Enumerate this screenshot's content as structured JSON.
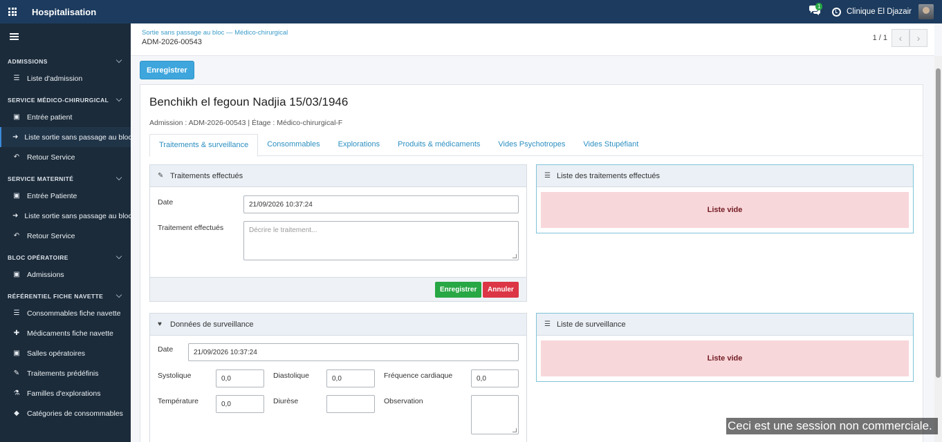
{
  "topbar": {
    "title": "Hospitalisation",
    "chat_badge": "1",
    "company": "Clinique El Djazair"
  },
  "sidebar": {
    "sections": [
      {
        "label": "ADMISSIONS",
        "items": [
          "Liste d'admission"
        ]
      },
      {
        "label": "SERVICE MÉDICO-CHIRURGICAL",
        "items": [
          "Entrée patient",
          "Liste sortie sans passage au bloc",
          "Retour Service"
        ]
      },
      {
        "label": "SERVICE MATERNITÉ",
        "items": [
          "Entrée Patiente",
          "Liste sortie sans passage au bloc",
          "Retour Service"
        ]
      },
      {
        "label": "BLOC OPÉRATOIRE",
        "items": [
          "Admissions"
        ]
      },
      {
        "label": "RÉFÉRENTIEL FICHE NAVETTE",
        "items": [
          "Consommables fiche navette",
          "Médicaments fiche navette",
          "Salles opératoires",
          "Traitements prédéfinis",
          "Familles d'explorations",
          "Catégories de consommables"
        ]
      }
    ]
  },
  "control": {
    "breadcrumb": "Sortie sans passage au bloc — Médico-chirurgical",
    "reference": "ADM-2026-00543",
    "pager": "1 / 1",
    "prev": "‹",
    "next": "›"
  },
  "save_button": "Enregistrer",
  "sheet": {
    "patient": "Benchikh el fegoun Nadjia 15/03/1946",
    "admission_info": "Admission : ADM-2026-00543 | Étage : Médico-chirurgical-F",
    "tabs": [
      "Traitements & surveillance",
      "Consommables",
      "Explorations",
      "Produits & médicaments",
      "Vides Psychotropes",
      "Vides Stupéfiant"
    ]
  },
  "treatments": {
    "title": "Traitements effectués",
    "date_label": "Date",
    "date_value": "21/09/2026 10:37:24",
    "treatment_label": "Traitement effectués",
    "treatment_placeholder": "Décrire le traitement...",
    "save": "Enregistrer",
    "cancel": "Annuler"
  },
  "treatments_list": {
    "title": "Liste des traitements effectués",
    "empty": "Liste vide"
  },
  "surveillance": {
    "title": "Données de surveillance",
    "date_label": "Date",
    "date_value": "21/09/2026 10:37:24",
    "systolique_label": "Systolique",
    "systolique": "0,0",
    "diastolique_label": "Diastolique",
    "diastolique": "0,0",
    "frequence_label": "Fréquence cardiaque",
    "frequence": "0,0",
    "temperature_label": "Température",
    "temperature": "0,0",
    "diurese_label": "Diurèse",
    "diurese": "",
    "observation_label": "Observation"
  },
  "surveillance_list": {
    "title": "Liste de surveillance",
    "empty": "Liste vide"
  },
  "watermark": "Ceci est une session non commerciale."
}
